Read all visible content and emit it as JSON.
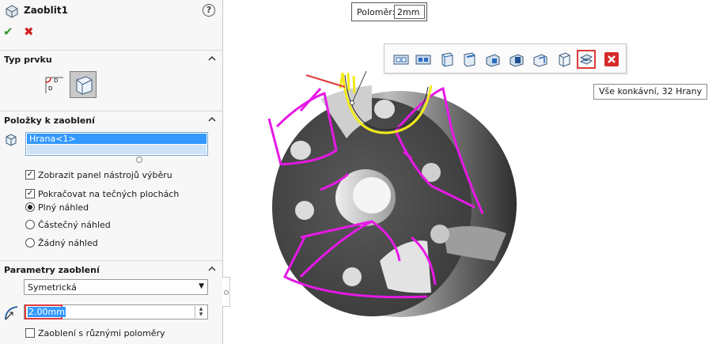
{
  "feature_manager": {
    "title": "Zaoblit1",
    "help_symbol": "?",
    "ok_symbol": "✔",
    "cancel_symbol": "✖",
    "sections": {
      "type": {
        "title": "Typ prvku"
      },
      "items": {
        "title": "Položky k zaoblení",
        "list_items": [
          "Hrana<1>"
        ],
        "options": [
          {
            "kind": "checkbox",
            "label": "Zobrazit panel nástrojů výběru",
            "checked": true
          },
          {
            "kind": "checkbox",
            "label": "Pokračovat na tečných plochách",
            "checked": true
          },
          {
            "kind": "radio",
            "label": "Plný náhled",
            "selected": true
          },
          {
            "kind": "radio",
            "label": "Částečný náhled",
            "selected": false
          },
          {
            "kind": "radio",
            "label": "Žádný náhled",
            "selected": false
          }
        ]
      },
      "params": {
        "title": "Parametry zaoblení",
        "profile_value": "Symetrická",
        "radius_value": "2.00mm",
        "multi_radius_label": "Zaoblení s různými poloměry",
        "multi_radius_checked": false
      }
    }
  },
  "callout": {
    "label": "Poloměr:",
    "value": "2mm"
  },
  "selection_toolbar": {
    "buttons": [
      {
        "icon": "select-loop-icon"
      },
      {
        "icon": "select-features-icon"
      },
      {
        "icon": "select-connected-icon"
      },
      {
        "icon": "select-tangency-icon"
      },
      {
        "icon": "select-convex-icon"
      },
      {
        "icon": "select-concave-icon"
      },
      {
        "icon": "select-all-convex-icon"
      },
      {
        "icon": "select-face-icon"
      },
      {
        "icon": "select-all-concave-icon",
        "highlighted": true
      },
      {
        "icon": "close-icon"
      }
    ],
    "tooltip": "Vše konkávní, 32 Hrany"
  },
  "colors": {
    "accent_red": "#e03a3a",
    "selection_blue": "#3399ff",
    "preview_magenta": "#e619e6",
    "selected_yellow": "#f2ea1a"
  }
}
